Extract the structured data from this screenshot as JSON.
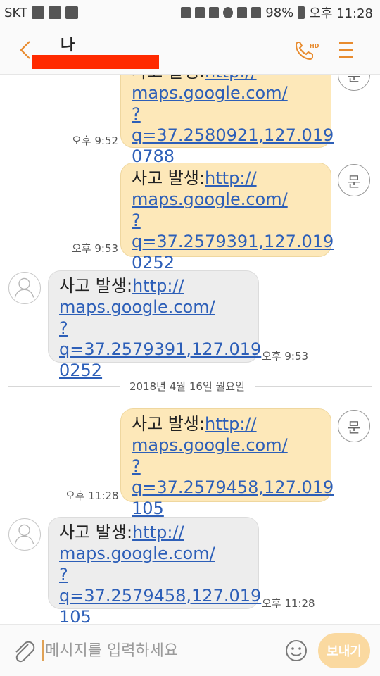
{
  "status_bar": {
    "carrier": "SKT",
    "battery": "98%",
    "time": "오후 11:28"
  },
  "header": {
    "title": "나"
  },
  "date_divider": "2018년 4월 16일 월요일",
  "sim_label": "문",
  "messages": [
    {
      "direction": "out",
      "lines": [
        "사고 발생:http://",
        "maps.google.com/",
        "?q=37.2580921,127.019",
        "0788"
      ],
      "time": "오후 9:52"
    },
    {
      "direction": "out",
      "lines": [
        "사고 발생:http://",
        "maps.google.com/",
        "?q=37.2579391,127.019",
        "0252"
      ],
      "time": "오후 9:53"
    },
    {
      "direction": "in",
      "lines": [
        "사고 발생:http://",
        "maps.google.com/",
        "?q=37.2579391,127.019",
        "0252"
      ],
      "time": "오후 9:53"
    },
    {
      "direction": "out",
      "lines": [
        "사고 발생:http://",
        "maps.google.com/",
        "?q=37.2579458,127.019",
        "105"
      ],
      "time": "오후 11:28"
    },
    {
      "direction": "in",
      "lines": [
        "사고 발생:http://",
        "maps.google.com/",
        "?q=37.2579458,127.019",
        "105"
      ],
      "time": "오후 11:28"
    }
  ],
  "composer": {
    "placeholder": "메시지를 입력하세요",
    "send_label": "보내기"
  },
  "colors": {
    "accent": "#e88b2e",
    "outgoing_bubble": "#fde8b9",
    "incoming_bubble": "#ededed",
    "link": "#2d5fb8",
    "redaction": "#ff2a00"
  }
}
